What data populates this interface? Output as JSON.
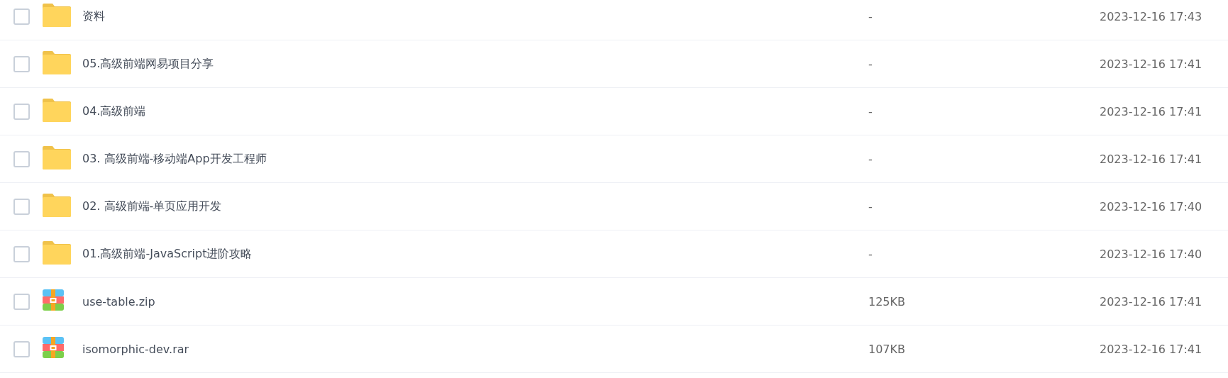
{
  "files": [
    {
      "kind": "folder",
      "name": "资料",
      "size": "-",
      "modified": "2023-12-16 17:43",
      "checked": false
    },
    {
      "kind": "folder",
      "name": "05.高级前端网易项目分享",
      "size": "-",
      "modified": "2023-12-16 17:41",
      "checked": false
    },
    {
      "kind": "folder",
      "name": "04.高级前端",
      "size": "-",
      "modified": "2023-12-16 17:41",
      "checked": false
    },
    {
      "kind": "folder",
      "name": "03. 高级前端-移动端App开发工程师",
      "size": "-",
      "modified": "2023-12-16 17:41",
      "checked": false
    },
    {
      "kind": "folder",
      "name": "02. 高级前端-单页应用开发",
      "size": "-",
      "modified": "2023-12-16 17:40",
      "checked": false
    },
    {
      "kind": "folder",
      "name": "01.高级前端-JavaScript进阶攻略",
      "size": "-",
      "modified": "2023-12-16 17:40",
      "checked": false
    },
    {
      "kind": "archive",
      "name": "use-table.zip",
      "size": "125KB",
      "modified": "2023-12-16 17:41",
      "checked": false
    },
    {
      "kind": "archive",
      "name": "isomorphic-dev.rar",
      "size": "107KB",
      "modified": "2023-12-16 17:41",
      "checked": false
    }
  ]
}
